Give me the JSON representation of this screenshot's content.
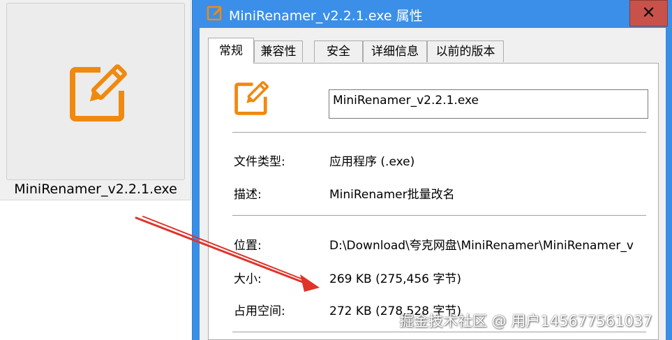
{
  "file_tile": {
    "icon": "edit-icon",
    "name": "MiniRenamer_v2.2.1.exe"
  },
  "window": {
    "title": "MiniRenamer_v2.2.1.exe 属性",
    "close_label": "✕",
    "tabs": [
      {
        "label": "常规",
        "active": true
      },
      {
        "label": "兼容性",
        "active": false
      },
      {
        "label": "安全",
        "active": false
      },
      {
        "label": "详细信息",
        "active": false
      },
      {
        "label": "以前的版本",
        "active": false
      }
    ],
    "general": {
      "file_name_value": "MiniRenamer_v2.2.1.exe",
      "rows": [
        {
          "label": "文件类型:",
          "value": "应用程序 (.exe)"
        },
        {
          "label": "描述:",
          "value": "MiniRenamer批量改名"
        },
        {
          "label": "位置:",
          "value": "D:\\Download\\夸克网盘\\MiniRenamer\\MiniRenamer_v"
        },
        {
          "label": "大小:",
          "value": "269 KB (275,456 字节)"
        },
        {
          "label": "占用空间:",
          "value": "272 KB (278,528 字节)"
        }
      ]
    }
  },
  "watermark": "掘金技术社区 @ 用户145677561037",
  "colors": {
    "icon_orange": "#f0890f",
    "titlebar_blue": "#3b8fe8",
    "close_red": "#c8524a",
    "arrow_red": "#e0342a"
  }
}
